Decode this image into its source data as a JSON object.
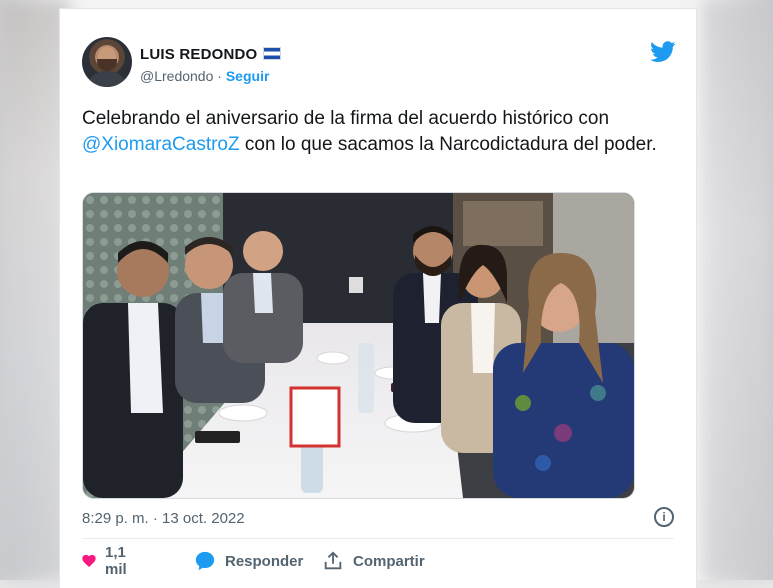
{
  "author": {
    "name": "LUIS REDONDO",
    "handle": "@Lredondo",
    "separator": "·",
    "follow_label": "Seguir"
  },
  "tweet": {
    "text_before": "Celebrando el aniversario de la firma del acuerdo histórico con ",
    "mention": "@XiomaraCastroZ",
    "text_after": " con lo que sacamos la Narcodictadura del poder."
  },
  "timestamp": "8:29 p. m. · 13 oct. 2022",
  "actions": {
    "likes": "1,1 mil",
    "reply_label": "Responder",
    "share_label": "Compartir"
  },
  "icons": {
    "logo": "twitter-bird-icon",
    "info": "info-icon",
    "like": "heart-icon",
    "reply": "speech-bubble-icon",
    "share": "share-icon"
  },
  "colors": {
    "accent": "#1d9bf0",
    "heart": "#f91880",
    "text": "#14171a",
    "muted": "#536471"
  }
}
